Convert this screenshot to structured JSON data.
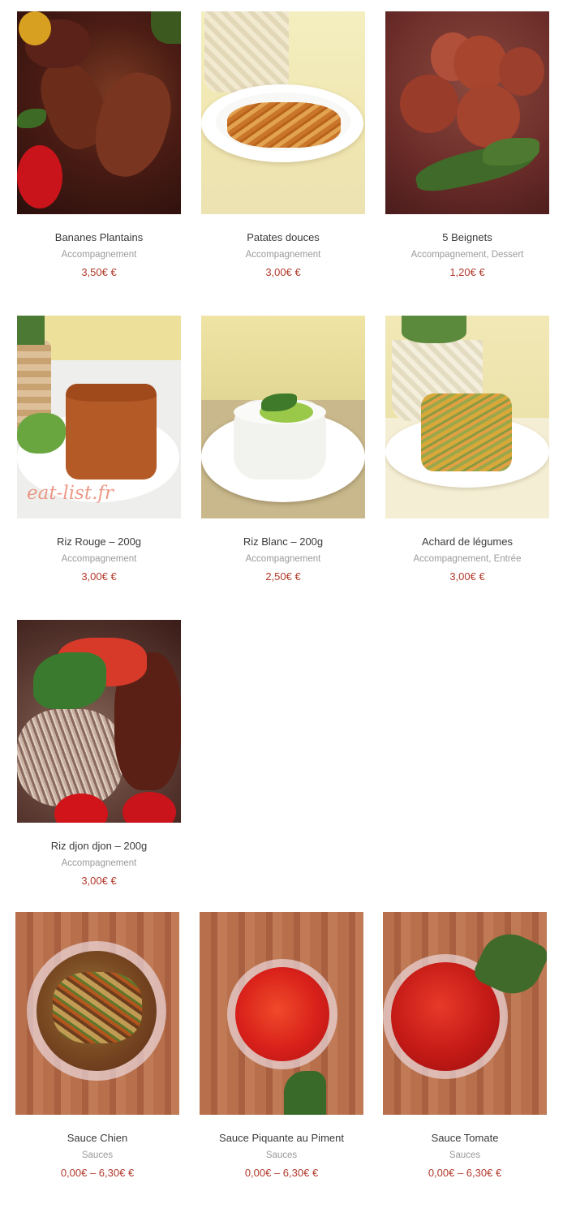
{
  "products": [
    {
      "title": "Bananes Plantains",
      "categories": [
        "Accompagnement"
      ],
      "price": "3,50€ €"
    },
    {
      "title": "Patates douces",
      "categories": [
        "Accompagnement"
      ],
      "price": "3,00€ €"
    },
    {
      "title": "5 Beignets",
      "categories": [
        "Accompagnement",
        "Dessert"
      ],
      "price": "1,20€ €"
    },
    {
      "title": "Riz Rouge – 200g",
      "categories": [
        "Accompagnement"
      ],
      "price": "3,00€ €",
      "watermark": "eat-list.fr"
    },
    {
      "title": "Riz Blanc – 200g",
      "categories": [
        "Accompagnement"
      ],
      "price": "2,50€ €"
    },
    {
      "title": "Achard de légumes",
      "categories": [
        "Accompagnement",
        "Entrée"
      ],
      "price": "3,00€ €"
    },
    {
      "title": "Riz djon djon – 200g",
      "categories": [
        "Accompagnement"
      ],
      "price": "3,00€ €"
    },
    {
      "title": "Sauce Chien",
      "categories": [
        "Sauces"
      ],
      "price": "0,00€ – 6,30€ €"
    },
    {
      "title": "Sauce Piquante au Piment",
      "categories": [
        "Sauces"
      ],
      "price": "0,00€ – 6,30€ €"
    },
    {
      "title": "Sauce Tomate",
      "categories": [
        "Sauces"
      ],
      "price": "0,00€ – 6,30€ €"
    }
  ],
  "category_separator": ", "
}
